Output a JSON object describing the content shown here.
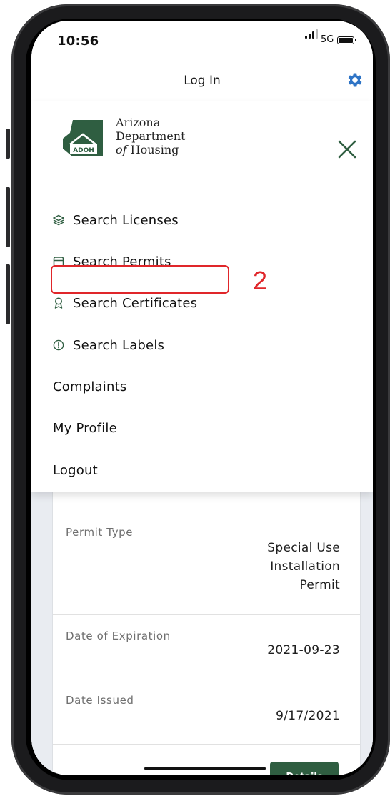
{
  "status_bar": {
    "time": "10:56",
    "network": "5G"
  },
  "header": {
    "title": "Log In",
    "settings_icon": "gear-icon"
  },
  "logo": {
    "line1": "Arizona",
    "line2": "Department",
    "line3_italic": "of",
    "line3": "Housing",
    "badge": "ADOH"
  },
  "menu": {
    "items": [
      {
        "label": "Search Licenses",
        "icon": "layers-icon"
      },
      {
        "label": "Search Permits",
        "icon": "permit-icon"
      },
      {
        "label": "Search Certificates",
        "icon": "certificate-icon"
      },
      {
        "label": "Search Labels",
        "icon": "alert-circle-icon"
      }
    ],
    "plain_items": [
      "Complaints",
      "My Profile",
      "Logout"
    ]
  },
  "annotation": {
    "number": "2"
  },
  "details": {
    "rows": [
      {
        "label": "Permit Type",
        "value_lines": [
          "Special Use",
          "Installation",
          "Permit"
        ]
      },
      {
        "label": "Date of Expiration",
        "value": "2021-09-23"
      },
      {
        "label": "Date Issued",
        "value": "9/17/2021"
      }
    ],
    "button": "Details"
  },
  "colors": {
    "brand_green": "#2f5e41",
    "accent_blue": "#2e74c6",
    "highlight_red": "#e0262a"
  }
}
